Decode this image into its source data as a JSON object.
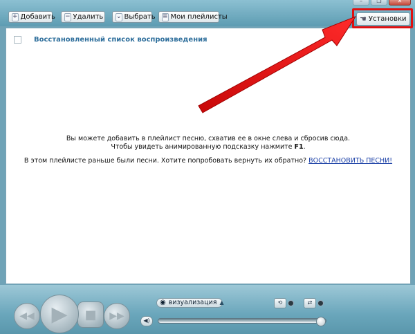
{
  "toolbar": {
    "add_label": "Добавить",
    "delete_label": "Удалить",
    "select_label": "Выбрать",
    "playlists_label": "Мои плейлисты",
    "settings_label": "Установки"
  },
  "playlist": {
    "title": "Восстановленный список воспроизведения",
    "message_line1": "Вы можете добавить в плейлист песню, схватив ее в окне слева и сбросив сюда.",
    "message_line2": "Чтобы увидеть анимированную подсказку нажмите ",
    "message_line2_key": "F1",
    "message_line2_end": ".",
    "message_line3": "В этом плейлисте раньше были песни. Хотите попробовать вернуть их обратно? ",
    "restore_link": "ВОССТАНОВИТЬ ПЕСНИ!"
  },
  "player": {
    "visualization_label": "визуализация"
  },
  "colors": {
    "annotation": "#e01010",
    "playlist_title": "#2f6f9c",
    "link": "#1a3fa6"
  },
  "icons": {
    "add": "plus-icon",
    "delete": "minus-icon",
    "select": "chevron-down-icon",
    "playlists": "list-icon",
    "settings": "hand-icon",
    "visualization": "eye-icon"
  }
}
